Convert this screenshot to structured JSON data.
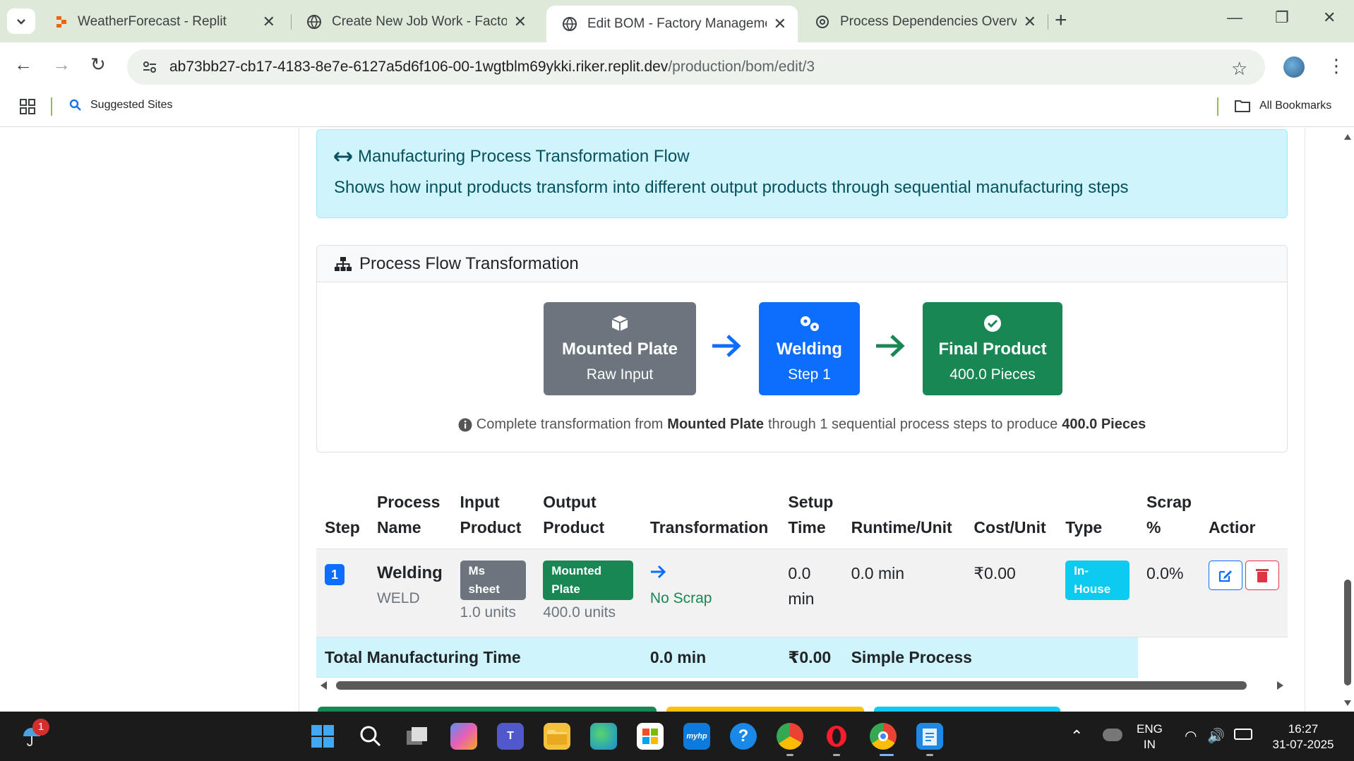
{
  "browser": {
    "tabs": [
      {
        "title": "WeatherForecast - Replit",
        "active": false
      },
      {
        "title": "Create New Job Work - Factory",
        "active": false
      },
      {
        "title": "Edit BOM - Factory Managemer",
        "active": true
      },
      {
        "title": "Process Dependencies Overview",
        "active": false
      }
    ],
    "url_host": "ab73bb27-cb17-4183-8e7e-6127a5d6f106-00-1wgtblm69ykki.riker.replit.dev",
    "url_path": "/production/bom/edit/3",
    "bookmarks": {
      "suggested": "Suggested Sites",
      "all": "All Bookmarks"
    }
  },
  "alert": {
    "title": "Manufacturing Process Transformation Flow",
    "description": "Shows how input products transform into different output products through sequential manufacturing steps"
  },
  "flow_card": {
    "header": "Process Flow Transformation",
    "input": {
      "title": "Mounted Plate",
      "subtitle": "Raw Input"
    },
    "step": {
      "title": "Welding",
      "subtitle": "Step 1"
    },
    "output": {
      "title": "Final Product",
      "subtitle": "400.0 Pieces"
    },
    "note": {
      "prefix": "Complete transformation from",
      "input": "Mounted Plate",
      "middle": "through 1 sequential process steps to produce",
      "output": "400.0 Pieces"
    }
  },
  "table": {
    "headers": {
      "step": "Step",
      "process_a": "Process",
      "process_b": "Name",
      "input_a": "Input",
      "input_b": "Product",
      "output_a": "Output",
      "output_b": "Product",
      "transformation": "Transformation",
      "setup_a": "Setup",
      "setup_b": "Time",
      "runtime": "Runtime/Unit",
      "cost": "Cost/Unit",
      "type": "Type",
      "scrap_a": "Scrap",
      "scrap_b": "%",
      "action": "Actior"
    },
    "rows": [
      {
        "step": "1",
        "process_name": "Welding",
        "process_code": "WELD",
        "input_product": "Ms sheet",
        "input_qty": "1.0 units",
        "output_product": "Mounted Plate",
        "output_qty": "400.0 units",
        "scrap_note": "No Scrap",
        "setup_time_a": "0.0",
        "setup_time_b": "min",
        "runtime": "0.0 min",
        "cost": "₹0.00",
        "type": "In-House",
        "scrap_pct": "0.0%"
      }
    ],
    "total": {
      "label": "Total Manufacturing Time",
      "time": "0.0 min",
      "cost": "₹0.00",
      "kind": "Simple Process"
    }
  },
  "taskbar": {
    "weather_badge": "1",
    "lang_a": "ENG",
    "lang_b": "IN",
    "time": "16:27",
    "date": "31-07-2025"
  },
  "colors": {
    "primary": "#0d6efd",
    "success": "#198754",
    "secondary": "#6c757d",
    "info_bg": "#cff4fc",
    "info_text": "#055160",
    "cyan": "#0dcaf0"
  }
}
